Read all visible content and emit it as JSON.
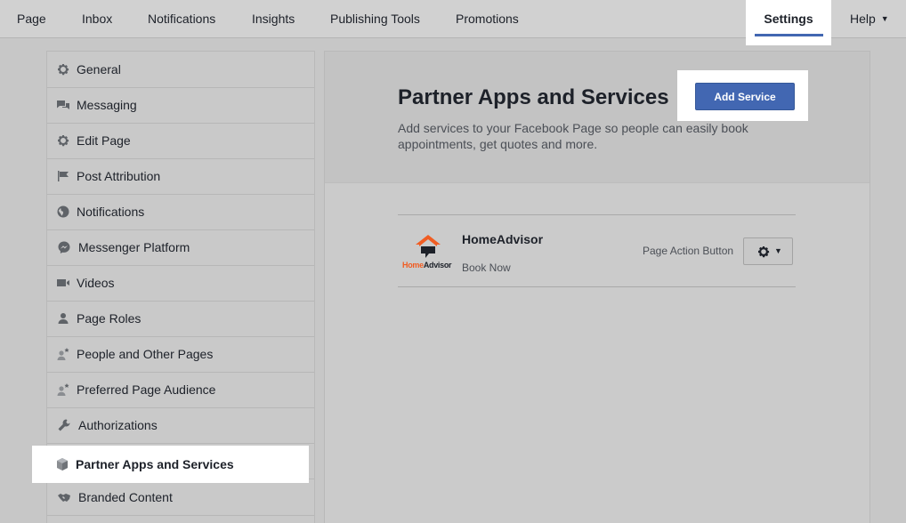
{
  "topnav": {
    "items": [
      "Page",
      "Inbox",
      "Notifications",
      "Insights",
      "Publishing Tools",
      "Promotions"
    ],
    "settings": "Settings",
    "help": "Help"
  },
  "sidebar": {
    "items": [
      {
        "label": "General",
        "icon": "gear-icon"
      },
      {
        "label": "Messaging",
        "icon": "chat-bubbles-icon"
      },
      {
        "label": "Edit Page",
        "icon": "gear-icon"
      },
      {
        "label": "Post Attribution",
        "icon": "flag-icon"
      },
      {
        "label": "Notifications",
        "icon": "globe-icon"
      },
      {
        "label": "Messenger Platform",
        "icon": "messenger-icon"
      },
      {
        "label": "Videos",
        "icon": "video-camera-icon"
      },
      {
        "label": "Page Roles",
        "icon": "person-icon"
      },
      {
        "label": "People and Other Pages",
        "icon": "person-star-icon"
      },
      {
        "label": "Preferred Page Audience",
        "icon": "person-star-icon"
      },
      {
        "label": "Authorizations",
        "icon": "wrench-icon"
      },
      {
        "label": "Partner Apps and Services",
        "icon": "cube-icon"
      },
      {
        "label": "Branded Content",
        "icon": "handshake-icon"
      }
    ],
    "active_index": 11
  },
  "main": {
    "title": "Partner Apps and Services",
    "description": "Add services to your Facebook Page so people can easily book appointments, get quotes and more.",
    "add_button": "Add Service",
    "service": {
      "name": "HomeAdvisor",
      "subtitle": "Book Now",
      "type": "Page Action Button",
      "logo_text_a": "Home",
      "logo_text_b": "Advisor"
    }
  },
  "colors": {
    "accent": "#4267b2",
    "logo_orange": "#f05d23"
  }
}
